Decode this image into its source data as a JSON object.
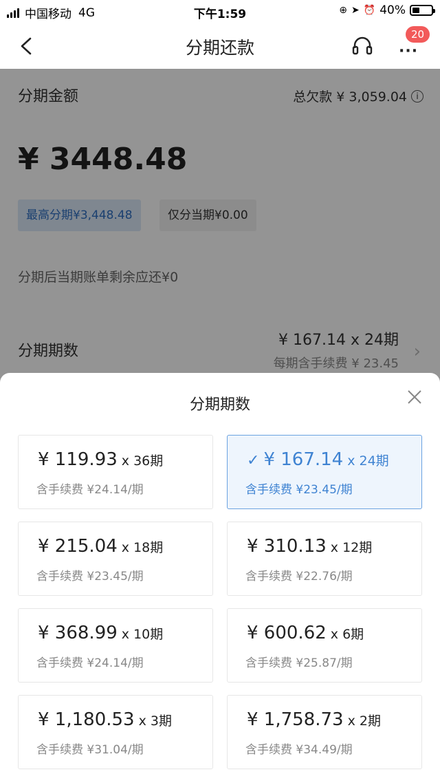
{
  "status_bar": {
    "carrier": "中国移动",
    "network": "4G",
    "time": "下午1:59",
    "battery": "40%",
    "battery_level": 0.4
  },
  "nav": {
    "title": "分期还款",
    "badge": "20",
    "icons": [
      "back-icon",
      "headset-icon",
      "more-icon"
    ]
  },
  "page": {
    "amount_label": "分期金额",
    "debt": "总欠款 ¥ 3,059.04",
    "amount": "¥ 3448.48",
    "chip_max": "最高分期¥3,448.48",
    "chip_current": "仅分当期¥0.00",
    "remaining": "分期后当期账单剩余应还¥0",
    "period_label": "分期期数",
    "period_value": "¥ 167.14 x 24期",
    "period_fee": "每期含手续费 ¥ 23.45"
  },
  "sheet": {
    "title": "分期期数",
    "options": [
      {
        "price": "¥ 119.93",
        "term": "x 36期",
        "fee": "含手续费 ¥24.14/期"
      },
      {
        "price": "¥ 167.14",
        "term": "x 24期",
        "fee": "含手续费 ¥23.45/期",
        "selected": true
      },
      {
        "price": "¥ 215.04",
        "term": "x 18期",
        "fee": "含手续费 ¥23.45/期"
      },
      {
        "price": "¥ 310.13",
        "term": "x 12期",
        "fee": "含手续费 ¥22.76/期"
      },
      {
        "price": "¥ 368.99",
        "term": "x 10期",
        "fee": "含手续费 ¥24.14/期"
      },
      {
        "price": "¥ 600.62",
        "term": "x 6期",
        "fee": "含手续费 ¥25.87/期"
      },
      {
        "price": "¥ 1,180.53",
        "term": "x 3期",
        "fee": "含手续费 ¥31.04/期"
      },
      {
        "price": "¥ 1,758.73",
        "term": "x 2期",
        "fee": "含手续费 ¥34.49/期"
      }
    ]
  },
  "colors": {
    "accent": "#3f83d2",
    "selected_bg": "#eef5fd",
    "badge": "#f25a5a"
  }
}
